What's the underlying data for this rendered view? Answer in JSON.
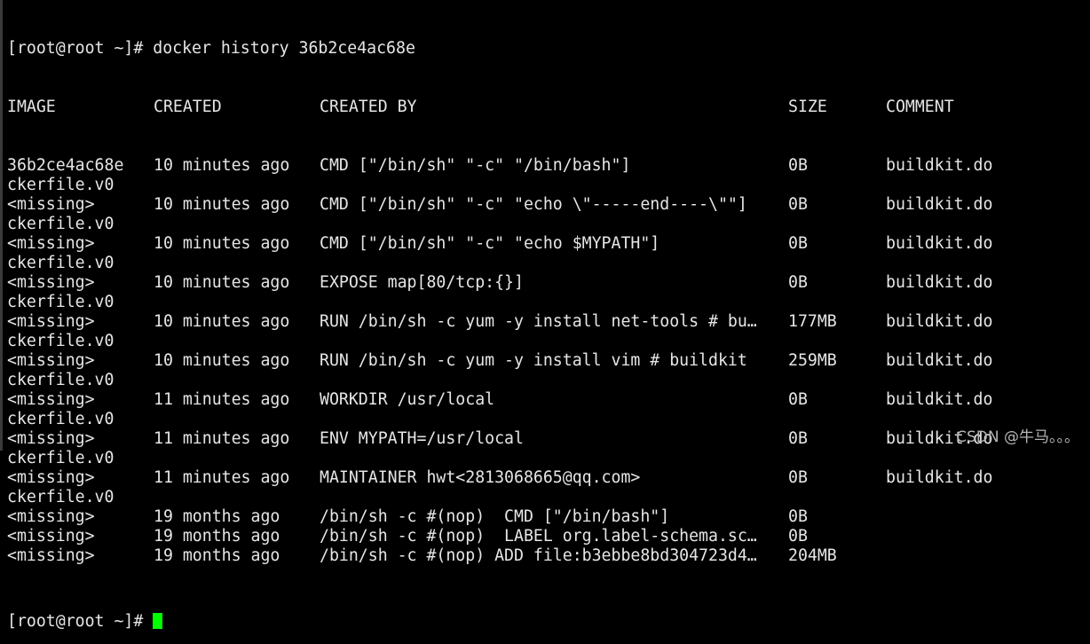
{
  "terminal": {
    "command_line": "[root@root ~]# docker history 36b2ce4ac68e",
    "headers": {
      "image": "IMAGE",
      "created": "CREATED",
      "created_by": "CREATED BY",
      "size": "SIZE",
      "comment": "COMMENT"
    },
    "rows": [
      {
        "image": "36b2ce4ac68e",
        "created": "10 minutes ago",
        "created_by": "CMD [\"/bin/sh\" \"-c\" \"/bin/bash\"]",
        "size": "0B",
        "comment": "buildkit.do",
        "wrap": "ckerfile.v0"
      },
      {
        "image": "<missing>",
        "created": "10 minutes ago",
        "created_by": "CMD [\"/bin/sh\" \"-c\" \"echo \\\"-----end----\\\"\"]",
        "size": "0B",
        "comment": "buildkit.do",
        "wrap": "ckerfile.v0"
      },
      {
        "image": "<missing>",
        "created": "10 minutes ago",
        "created_by": "CMD [\"/bin/sh\" \"-c\" \"echo $MYPATH\"]",
        "size": "0B",
        "comment": "buildkit.do",
        "wrap": "ckerfile.v0"
      },
      {
        "image": "<missing>",
        "created": "10 minutes ago",
        "created_by": "EXPOSE map[80/tcp:{}]",
        "size": "0B",
        "comment": "buildkit.do",
        "wrap": "ckerfile.v0"
      },
      {
        "image": "<missing>",
        "created": "10 minutes ago",
        "created_by": "RUN /bin/sh -c yum -y install net-tools # bu…",
        "size": "177MB",
        "comment": "buildkit.do",
        "wrap": "ckerfile.v0"
      },
      {
        "image": "<missing>",
        "created": "10 minutes ago",
        "created_by": "RUN /bin/sh -c yum -y install vim # buildkit",
        "size": "259MB",
        "comment": "buildkit.do",
        "wrap": "ckerfile.v0"
      },
      {
        "image": "<missing>",
        "created": "11 minutes ago",
        "created_by": "WORKDIR /usr/local",
        "size": "0B",
        "comment": "buildkit.do",
        "wrap": "ckerfile.v0"
      },
      {
        "image": "<missing>",
        "created": "11 minutes ago",
        "created_by": "ENV MYPATH=/usr/local",
        "size": "0B",
        "comment": "buildkit.do",
        "wrap": "ckerfile.v0"
      },
      {
        "image": "<missing>",
        "created": "11 minutes ago",
        "created_by": "MAINTAINER hwt<2813068665@qq.com>",
        "size": "0B",
        "comment": "buildkit.do",
        "wrap": "ckerfile.v0"
      },
      {
        "image": "<missing>",
        "created": "19 months ago",
        "created_by": "/bin/sh -c #(nop)  CMD [\"/bin/bash\"]",
        "size": "0B",
        "comment": ""
      },
      {
        "image": "<missing>",
        "created": "19 months ago",
        "created_by": "/bin/sh -c #(nop)  LABEL org.label-schema.sc…",
        "size": "0B",
        "comment": ""
      },
      {
        "image": "<missing>",
        "created": "19 months ago",
        "created_by": "/bin/sh -c #(nop) ADD file:b3ebbe8bd304723d4…",
        "size": "204MB",
        "comment": ""
      }
    ],
    "final_prompt": "[root@root ~]# ",
    "cursor_color": "#00ff00"
  },
  "watermark": "CSDN @牛马。。。"
}
